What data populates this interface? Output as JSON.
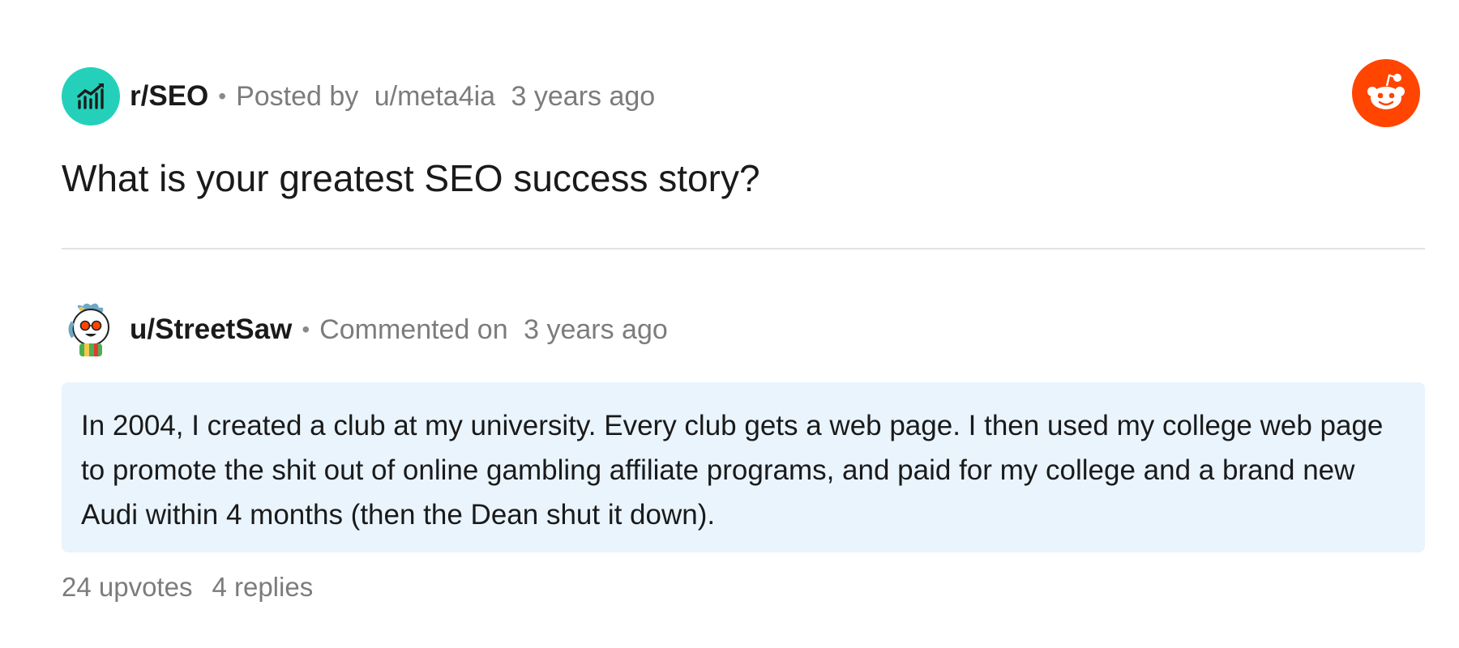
{
  "post": {
    "subreddit": "r/SEO",
    "separator": "•",
    "posted_by_prefix": "Posted by",
    "author": "u/meta4ia",
    "time": "3 years ago",
    "title": "What is your greatest SEO success story?"
  },
  "comment": {
    "author": "u/StreetSaw",
    "separator": "•",
    "commented_prefix": "Commented on",
    "time": "3 years ago",
    "body": "In 2004, I created a club at my university. Every club gets a web page. I then used my college web page to promote the shit out of online gambling affiliate programs, and paid for my college and a brand new Audi within 4 months (then the Dean shut it down).",
    "upvotes": "24 upvotes",
    "replies": "4 replies"
  },
  "colors": {
    "subreddit_avatar": "#25d0ba",
    "reddit_brand": "#ff4500",
    "comment_background": "#e9f4fc",
    "meta_text": "#7c7c7c"
  },
  "icons": {
    "subreddit": "bar-chart-icon",
    "brand": "reddit-snoo-icon",
    "user": "user-avatar-icon"
  }
}
